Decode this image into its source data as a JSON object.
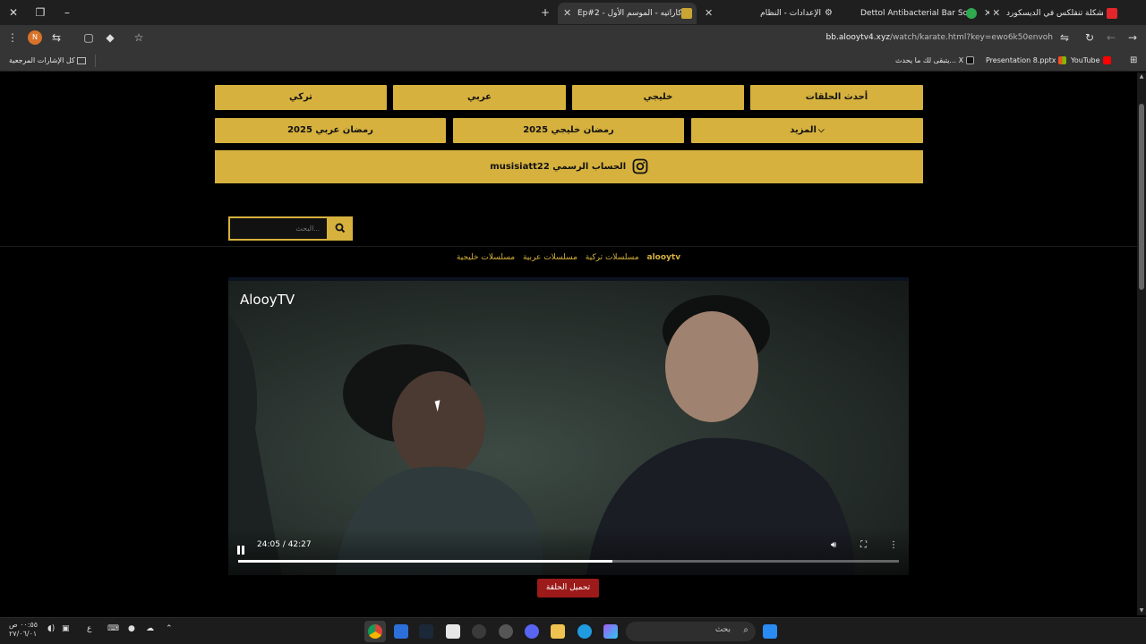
{
  "browser": {
    "tabs": [
      {
        "label": "حل مشكلة تنقلكس في الديسكورد",
        "active": false
      },
      {
        "label": "Dettol Antibacterial Bar Soap O",
        "active": false
      },
      {
        "label": "الإعدادات - النظام",
        "active": false
      },
      {
        "label": "Ep#2 - كاراتيه - الموسم الأول",
        "active": true
      }
    ],
    "profile_initial": "N",
    "url_host": "bb.alooytv4.xyz",
    "url_path": "/watch/karate.html?key=ewo6k50envoh"
  },
  "bookmarks": {
    "items": [
      {
        "label": "YouTube",
        "color": "#ff0000"
      },
      {
        "label": "Presentation 8.pptx",
        "color": "#f25022"
      },
      {
        "label": "يتبقى لك ما يحدث... X",
        "color": "#111111"
      }
    ],
    "all_bookmarks": "كل الإشارات المرجعية"
  },
  "nav": {
    "row1": [
      "أحدث الحلقات",
      "خليجي",
      "عربي",
      "تركي"
    ],
    "row2": [
      "المزيد",
      "رمضان خليجي 2025",
      "رمضان عربي 2025"
    ],
    "instagram": "musisiatt22 الحساب الرسمي"
  },
  "search": {
    "placeholder": "...البحث"
  },
  "breadcrumb": [
    "alooytv",
    "مسلسلات خليجية",
    "مسلسلات عربية",
    "مسلسلات تركية"
  ],
  "player": {
    "logo": "AlooyTV",
    "current_time": "24:05",
    "duration": "42:27",
    "time_display": "24:05 / 42:27",
    "progress": 0.567
  },
  "download_label": "تحميل الحلقة",
  "taskbar": {
    "search_label": "بحث",
    "tray_time": "٠٠:٥٥ ص",
    "tray_date": "٢٧/٠٦/٠١",
    "lang": "ع"
  }
}
